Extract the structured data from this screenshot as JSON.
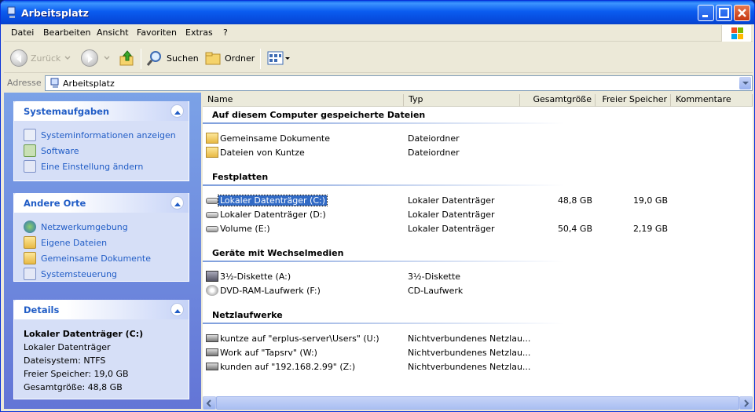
{
  "window": {
    "title": "Arbeitsplatz"
  },
  "menu": [
    "Datei",
    "Bearbeiten",
    "Ansicht",
    "Favoriten",
    "Extras",
    "?"
  ],
  "toolbar": {
    "back": "Zurück",
    "search": "Suchen",
    "folders": "Ordner"
  },
  "address": {
    "label": "Adresse",
    "value": "Arbeitsplatz"
  },
  "tasks": {
    "title": "Systemaufgaben",
    "items": [
      "Systeminformationen anzeigen",
      "Software",
      "Eine Einstellung ändern"
    ]
  },
  "places": {
    "title": "Andere Orte",
    "items": [
      "Netzwerkumgebung",
      "Eigene Dateien",
      "Gemeinsame Dokumente",
      "Systemsteuerung"
    ]
  },
  "details": {
    "title": "Details",
    "name": "Lokaler Datenträger (C:)",
    "type": "Lokaler Datenträger",
    "fs": "Dateisystem: NTFS",
    "free": "Freier Speicher: 19,0 GB",
    "total": "Gesamtgröße: 48,8 GB"
  },
  "columns": [
    "Name",
    "Typ",
    "Gesamtgröße",
    "Freier Speicher",
    "Kommentare"
  ],
  "groups": [
    {
      "title": "Auf diesem Computer gespeicherte Dateien",
      "items": [
        {
          "name": "Gemeinsame Dokumente",
          "type": "Dateiordner",
          "icon": "folder"
        },
        {
          "name": "Dateien von Kuntze",
          "type": "Dateiordner",
          "icon": "folder"
        }
      ]
    },
    {
      "title": "Festplatten",
      "items": [
        {
          "name": "Lokaler Datenträger (C:)",
          "type": "Lokaler Datenträger",
          "total": "48,8 GB",
          "free": "19,0 GB",
          "icon": "drive",
          "selected": true
        },
        {
          "name": "Lokaler Datenträger (D:)",
          "type": "Lokaler Datenträger",
          "icon": "drive"
        },
        {
          "name": "Volume (E:)",
          "type": "Lokaler Datenträger",
          "total": "50,4 GB",
          "free": "2,19 GB",
          "icon": "drive"
        }
      ]
    },
    {
      "title": "Geräte mit Wechselmedien",
      "items": [
        {
          "name": "3½-Diskette (A:)",
          "type": "3½-Diskette",
          "icon": "floppy"
        },
        {
          "name": "DVD-RAM-Laufwerk (F:)",
          "type": "CD-Laufwerk",
          "icon": "dvd"
        }
      ]
    },
    {
      "title": "Netzlaufwerke",
      "items": [
        {
          "name": "kuntze auf \"erplus-server\\Users\" (U:)",
          "type": "Nichtverbundenes Netzlau...",
          "icon": "net"
        },
        {
          "name": "Work auf \"Tapsrv\" (W:)",
          "type": "Nichtverbundenes Netzlau...",
          "icon": "net"
        },
        {
          "name": "kunden auf \"192.168.2.99\" (Z:)",
          "type": "Nichtverbundenes Netzlau...",
          "icon": "net"
        }
      ]
    }
  ]
}
